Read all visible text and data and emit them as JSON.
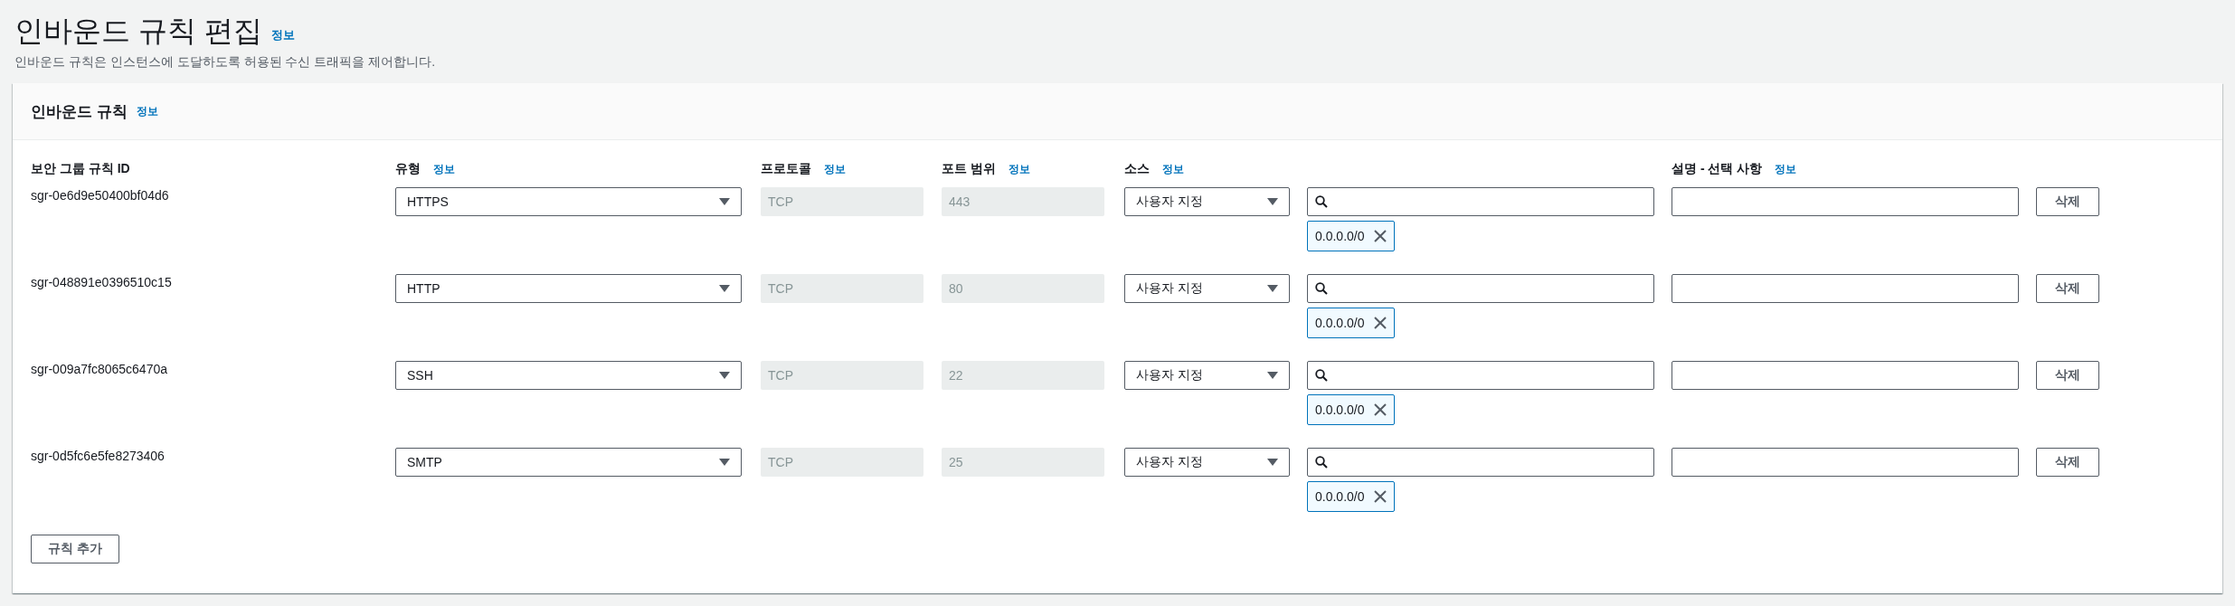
{
  "page": {
    "title": "인바운드 규칙 편집",
    "info_link": "정보",
    "description": "인바운드 규칙은 인스턴스에 도달하도록 허용된 수신 트래픽을 제어합니다."
  },
  "panel": {
    "title": "인바운드 규칙",
    "info_link": "정보"
  },
  "columns": [
    {
      "label": "보안 그룹 규칙 ID"
    },
    {
      "label": "유형",
      "info_link": "정보"
    },
    {
      "label": "프로토콜",
      "info_link": "정보"
    },
    {
      "label": "포트 범위",
      "info_link": "정보"
    },
    {
      "label": "소스",
      "info_link": "정보"
    },
    {},
    {
      "label": "설명 - 선택 사항",
      "info_link": "정보"
    }
  ],
  "rules": [
    {
      "id": "sgr-0e6d9e50400bf04d6",
      "type": "HTTPS",
      "protocol": "TCP",
      "port_range": "443",
      "source": "사용자 지정",
      "cidr": "0.0.0.0/0",
      "delete": "삭제"
    },
    {
      "id": "sgr-048891e0396510c15",
      "type": "HTTP",
      "protocol": "TCP",
      "port_range": "80",
      "source": "사용자 지정",
      "cidr": "0.0.0.0/0",
      "delete": "삭제"
    },
    {
      "id": "sgr-009a7fc8065c6470a",
      "type": "SSH",
      "protocol": "TCP",
      "port_range": "22",
      "source": "사용자 지정",
      "cidr": "0.0.0.0/0",
      "delete": "삭제"
    },
    {
      "id": "sgr-0d5fc6e5fe8273406",
      "type": "SMTP",
      "protocol": "TCP",
      "port_range": "25",
      "source": "사용자 지정",
      "cidr": "0.0.0.0/0",
      "delete": "삭제"
    }
  ],
  "add_button": "규칙 추가"
}
